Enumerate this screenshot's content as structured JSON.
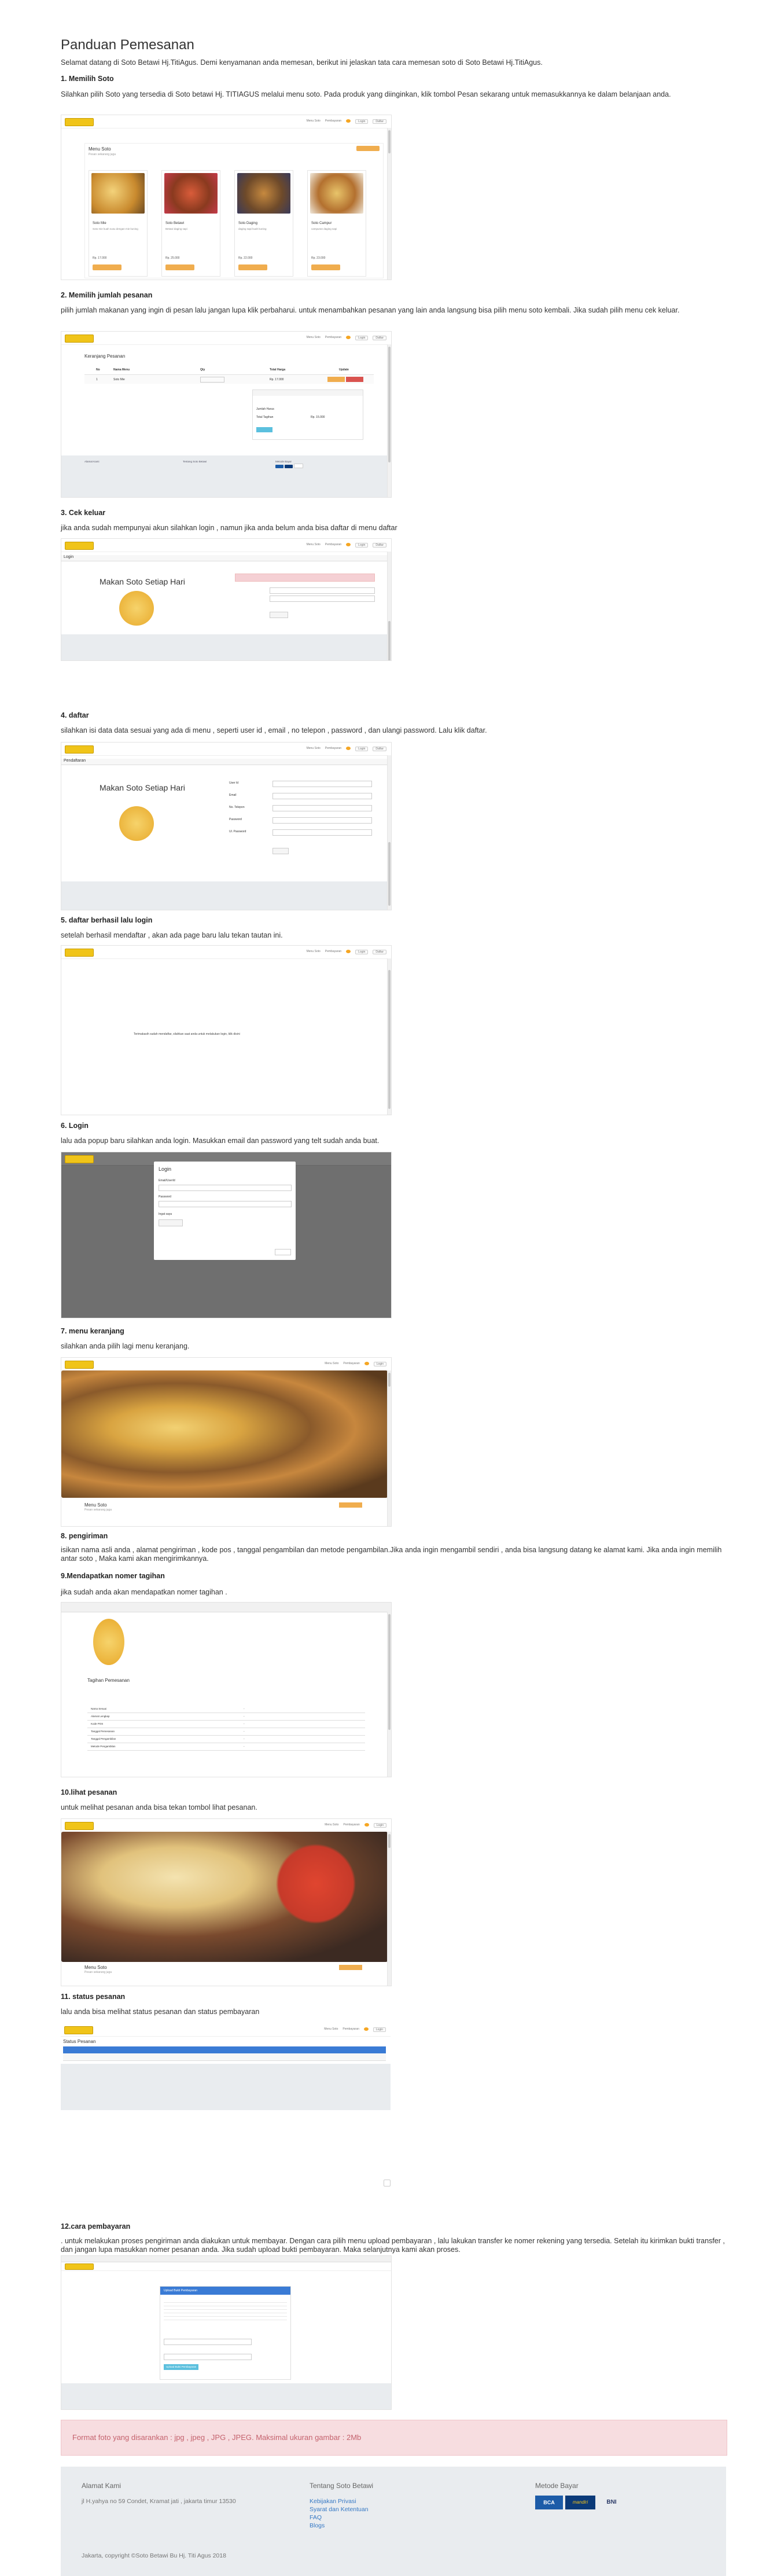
{
  "page": {
    "title": "Panduan Pemesanan",
    "intro": "Selamat datang di Soto Betawi Hj.TitiAgus. Demi kenyamanan anda memesan, berikut ini jelaskan tata cara memesan soto di Soto Betawi Hj.TitiAgus."
  },
  "steps": [
    {
      "title": "1. Memilih Soto",
      "desc": "Silahkan pilih Soto yang tersedia di Soto betawi Hj. TITIAGUS melalui menu soto. Pada produk yang diinginkan, klik tombol Pesan sekarang untuk memasukkannya ke dalam belanjaan anda."
    },
    {
      "title": "2. Memilih jumlah pesanan",
      "desc": "pilih jumlah makanan yang ingin di pesan lalu jangan lupa klik perbaharui. untuk menambahkan pesanan yang lain anda langsung bisa pilih menu soto kembali. Jika sudah pilih menu cek keluar."
    },
    {
      "title": "3. Cek keluar",
      "desc": "jika anda sudah mempunyai akun silahkan login , namun jika anda belum anda bisa daftar di menu daftar"
    },
    {
      "title": "4. daftar",
      "desc": "silahkan isi data data sesuai yang ada di menu , seperti user id , email , no telepon , password , dan ulangi password. Lalu klik daftar."
    },
    {
      "title": "5. daftar berhasil lalu login",
      "desc": "setelah berhasil mendaftar , akan ada page baru lalu tekan tautan ini."
    },
    {
      "title": "6. Login",
      "desc": "lalu ada popup baru silahkan anda login. Masukkan email dan password yang telt sudah anda buat."
    },
    {
      "title": "7. menu keranjang",
      "desc": "silahkan anda pilih lagi menu keranjang."
    },
    {
      "title": "8. pengiriman",
      "desc": "isikan nama asli anda , alamat pengiriman , kode pos , tanggal pengambilan dan metode pengambilan.Jika anda ingin mengambil sendiri , anda bisa langsung datang ke alamat kami. Jika anda ingin memilih antar soto , Maka kami akan mengirimkannya."
    },
    {
      "title": "9.Mendapatkan nomer tagihan",
      "desc": "jika sudah anda akan mendapatkan nomer tagihan ."
    },
    {
      "title": "10.lihat pesanan",
      "desc": "untuk melihat pesanan anda bisa tekan tombol lihat pesanan."
    },
    {
      "title": "11. status pesanan",
      "desc": "lalu anda bisa melihat status pesanan dan status pembayaran"
    },
    {
      "title": "12.cara pembayaran",
      "desc": ". untuk melakukan proses pengiriman anda diakukan untuk membayar. Dengan cara pilih menu upload pembayaran , lalu lakukan transfer ke nomer rekening yang tersedia. Setelah itu kirimkan bukti transfer , dan jangan lupa masukkan nomer pesanan anda. Jika sudah upload bukti pembayaran. Maka selanjutnya kami akan proses."
    }
  ],
  "shots": {
    "nav_items": [
      "Menu Soto",
      "Pembayaran",
      "Login",
      "Daftar"
    ],
    "menu_title": "Menu Soto",
    "menu_sub": "Pesan sekarang juga",
    "cards": [
      {
        "name": "Soto Mie",
        "desc": "Soto mie kuah susu dengan mie kuning",
        "price": "Rp. 17.000"
      },
      {
        "name": "Soto Betawi",
        "desc": "Betawi daging sapi",
        "price": "Rp. 25.000"
      },
      {
        "name": "Soto Daging",
        "desc": "daging sapi kuah kuning",
        "price": "Rp. 22.000"
      },
      {
        "name": "Soto Campur",
        "desc": "campuran daging sapi",
        "price": "Rp. 23.000"
      }
    ],
    "cart_title": "Keranjang Pesanan",
    "cart_cols": [
      "No",
      "Nama Menu",
      "Qty",
      "Total Harga",
      "Update"
    ],
    "cart_row": [
      "1",
      "Soto Mie",
      "1",
      "Rp. 17.000"
    ],
    "cart_summary": [
      "Jumlah Harus",
      "Total Tagihan",
      "Rp. 15.000"
    ],
    "login_title": "Login",
    "login_tagline": "Makan Soto Setiap Hari",
    "daftar_title": "Pendaftaran",
    "daftar_fields": [
      "User Id",
      "Email",
      "No. Telepon",
      "Password",
      "Ul. Password"
    ],
    "success_text": "Terimakasih sudah mendaftar, silahkan saat anda untuk melakukan login, klik disini",
    "popup_title": "Login",
    "popup_fields": [
      "Email/UserId",
      "Password"
    ],
    "popup_remember": "Ingat saya",
    "invoice_title": "Tagihan Pemesanan",
    "invoice_rows": [
      [
        "Nama Sesuai",
        "-"
      ],
      [
        "Alamat Lengkap",
        "-"
      ],
      [
        "Kode POS",
        "-"
      ],
      [
        "Tanggal Pemesanan",
        "-"
      ],
      [
        "Tanggal Pengambilan",
        "-"
      ],
      [
        "Metode Pengambilan",
        "-"
      ]
    ],
    "status_title": "Status Pesanan",
    "upload_title": "Upload Bukti Pembayaran",
    "upload_btn": "Upload Bukti Pembayaran"
  },
  "banner": "Format foto yang disarankan : jpg , jpeg , JPG , JPEG. Maksimal ukuran gambar : 2Mb",
  "footer": {
    "address_h": "Alamat Kami",
    "address": "jl H.yahya no 59 Condet, Kramat jati , jakarta timur 13530",
    "about_h": "Tentang Soto Betawi",
    "links": [
      "Kebijakan Privasi",
      "Syarat dan Ketentuan",
      "FAQ",
      "Blogs"
    ],
    "pay_h": "Metode Bayar",
    "pay": [
      "BCA",
      "mandiri",
      "BNI"
    ],
    "copyright": "Jakarta, copyright ©Soto Betawi Bu Hj. Titi Agus 2018"
  },
  "colors": {
    "accent": "#f0ad4e",
    "banner_text": "#c5636e",
    "banner_bg": "#f7dde0",
    "footer_bg": "#e9ecef",
    "link": "#3578c4"
  }
}
